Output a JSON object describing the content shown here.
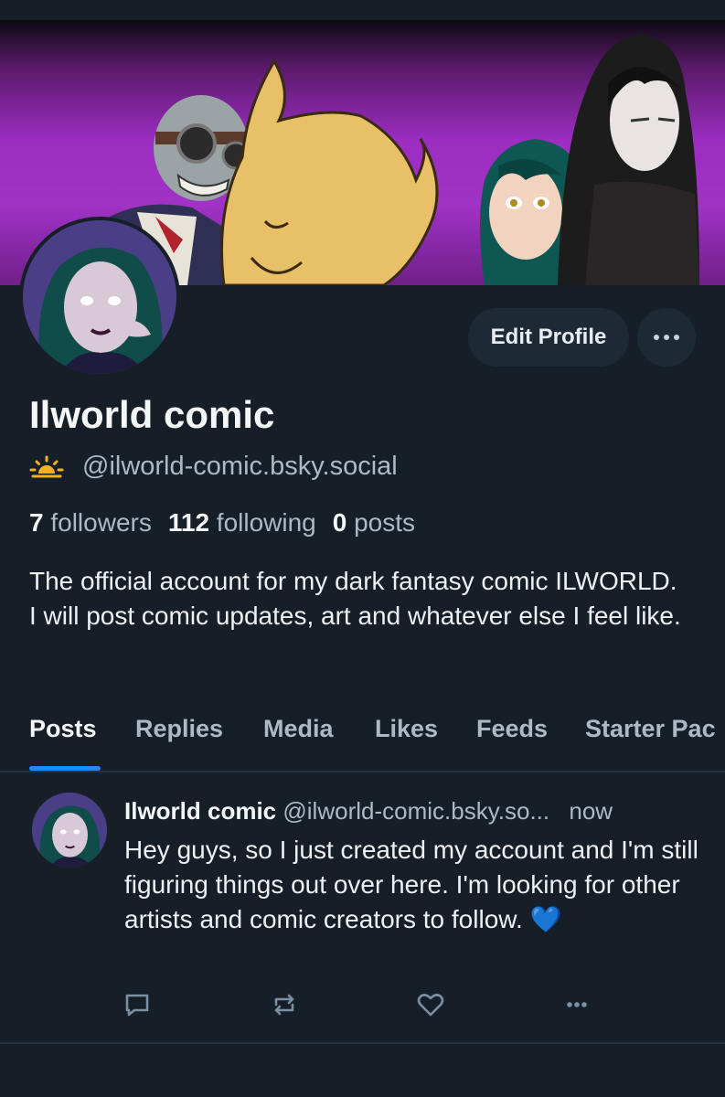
{
  "profile": {
    "display_name": "Ilworld comic",
    "handle": "@ilworld-comic.bsky.social",
    "handle_icon": "sunrise-icon",
    "followers_count": "7",
    "followers_label": "followers",
    "following_count": "112",
    "following_label": "following",
    "posts_count": "0",
    "posts_label": "posts",
    "bio": "The official account for my dark fantasy comic ILWORLD. I will post comic updates, art and whatever else I feel like.",
    "edit_label": "Edit Profile"
  },
  "tabs": [
    "Posts",
    "Replies",
    "Media",
    "Likes",
    "Feeds",
    "Starter Pac"
  ],
  "active_tab": "Posts",
  "post": {
    "author": "Ilworld comic",
    "handle": "@ilworld-comic.bsky.so...",
    "time": "now",
    "text": "Hey guys, so I just created my account and I'm still figuring things out over here. I'm looking for other artists and comic creators to follow. 💙"
  },
  "colors": {
    "background": "#161e27",
    "accent": "#1f8af5",
    "banner_purple": "#a032c6",
    "button_bg": "#1e2936"
  }
}
